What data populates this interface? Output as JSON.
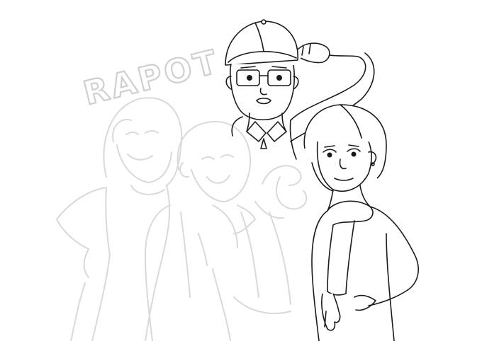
{
  "sketch": {
    "title_word": "RAPOT",
    "colors": {
      "background": "#ffffff",
      "faint_lines": "#d9d9d9",
      "ink_lines": "#1a1a1a"
    }
  }
}
